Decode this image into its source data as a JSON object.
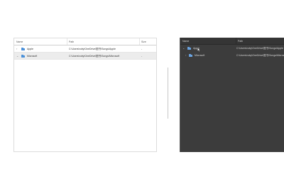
{
  "light_pane": {
    "columns": [
      "Name",
      "Path",
      "Size"
    ],
    "rows": [
      {
        "chevron": "›",
        "name": "Apple",
        "path": "C:\\Users\\ruby\\OneDrive\\图书\\Songs\\Apple",
        "size": "-"
      },
      {
        "chevron": "⌄",
        "name": "Microsoft",
        "path": "C:\\Users\\ruby\\OneDrive\\图书\\Songs\\Microsoft",
        "size": "-"
      }
    ]
  },
  "dark_pane": {
    "columns": [
      "Name",
      "Path"
    ],
    "rows": [
      {
        "chevron": "⌄",
        "name": "Apple",
        "path": "C:\\Users\\ruby\\OneDrive\\图书\\Songs\\Apple"
      },
      {
        "chevron": "›",
        "name": "Microsoft",
        "path": "C:\\Users\\ruby\\OneDrive\\图书\\Songs\\Microsoft"
      }
    ]
  },
  "colors": {
    "folder": "#4a90d9",
    "dark_background": "#3c3c3c",
    "light_background": "#ffffff"
  },
  "icons": [
    "chevron-icon",
    "folder-icon",
    "mouse-cursor-icon"
  ]
}
